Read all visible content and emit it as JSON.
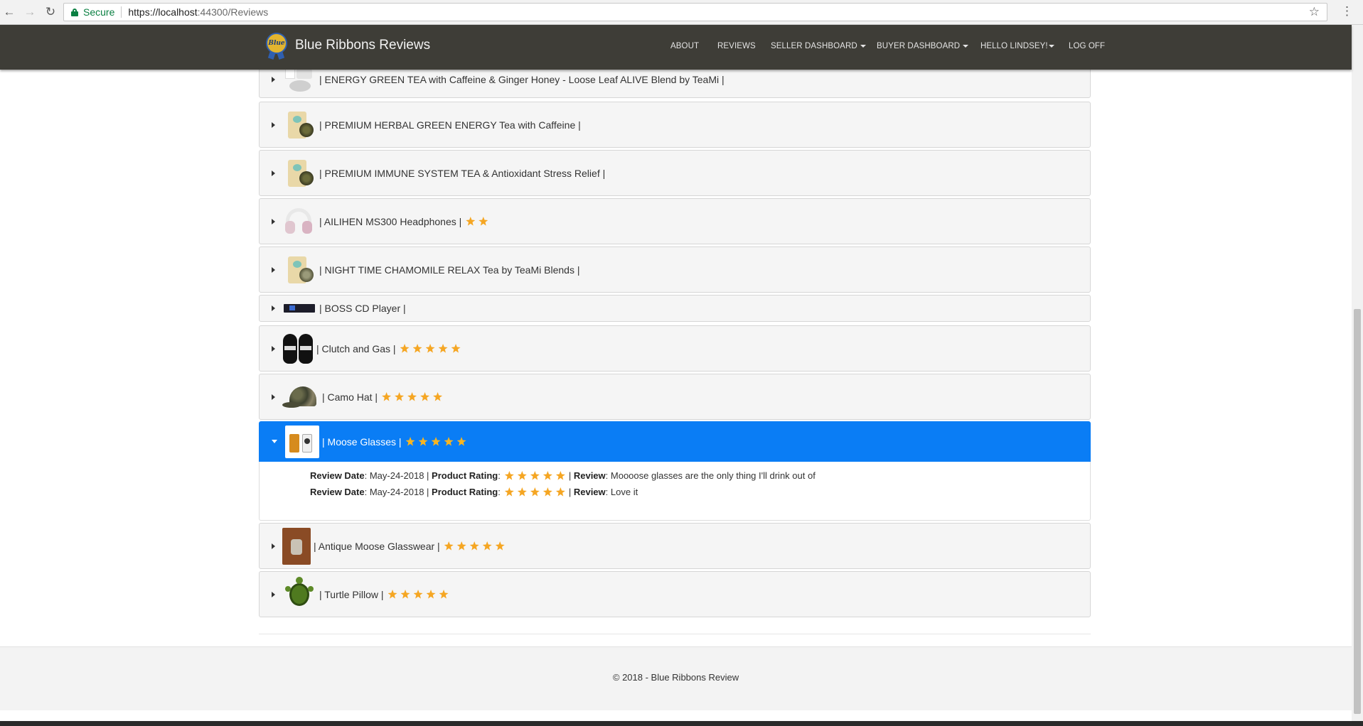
{
  "browser": {
    "secure_label": "Secure",
    "url_host": "https://localhost",
    "url_rest": ":44300/Reviews"
  },
  "navbar": {
    "brand": "Blue Ribbons Reviews",
    "logo_text": "Blue",
    "links": {
      "about": "ABOUT",
      "reviews": "REVIEWS",
      "seller": "SELLER DASHBOARD",
      "buyer": "BUYER DASHBOARD",
      "hello": "HELLO LINDSEY!",
      "logoff": "LOG OFF"
    }
  },
  "products": [
    {
      "title": "| ENERGY GREEN TEA with Caffeine & Ginger Honey - Loose Leaf ALIVE Blend by TeaMi |",
      "rating": 0,
      "thumb": "tea-sampler"
    },
    {
      "title": "| PREMIUM HERBAL GREEN ENERGY Tea with Caffeine |",
      "rating": 0,
      "thumb": "tea-bag"
    },
    {
      "title": "| PREMIUM IMMUNE SYSTEM TEA & Antioxidant Stress Relief |",
      "rating": 0,
      "thumb": "tea-bag"
    },
    {
      "title": "| AILIHEN MS300 Headphones |",
      "rating": 2,
      "thumb": "headphones"
    },
    {
      "title": "| NIGHT TIME CHAMOMILE RELAX Tea by TeaMi Blends |",
      "rating": 0,
      "thumb": "tea-bag"
    },
    {
      "title": "| BOSS CD Player |",
      "rating": 0,
      "thumb": "cd-player"
    },
    {
      "title": "| Clutch and Gas |",
      "rating": 5,
      "thumb": "socks"
    },
    {
      "title": "| Camo Hat |",
      "rating": 5,
      "thumb": "camo-hat"
    },
    {
      "title": "| Moose Glasses |",
      "rating": 5,
      "thumb": "moose-glasses",
      "expanded": true
    },
    {
      "title": "| Antique Moose Glasswear |",
      "rating": 5,
      "thumb": "antique-glass"
    },
    {
      "title": "| Turtle Pillow |",
      "rating": 5,
      "thumb": "turtle"
    }
  ],
  "reviews": {
    "date_label": "Review Date",
    "rating_label": "Product Rating",
    "review_label": "Review",
    "items": [
      {
        "date": "May-24-2018",
        "rating": 5,
        "text": "Moooose glasses are the only thing I'll drink out of"
      },
      {
        "date": "May-24-2018",
        "rating": 5,
        "text": "Love it"
      }
    ]
  },
  "footer": {
    "text": "© 2018 - Blue Ribbons Review"
  },
  "colors": {
    "navbar": "#3e3d37",
    "active_panel": "#0a7df5",
    "star": "#f5a623"
  }
}
